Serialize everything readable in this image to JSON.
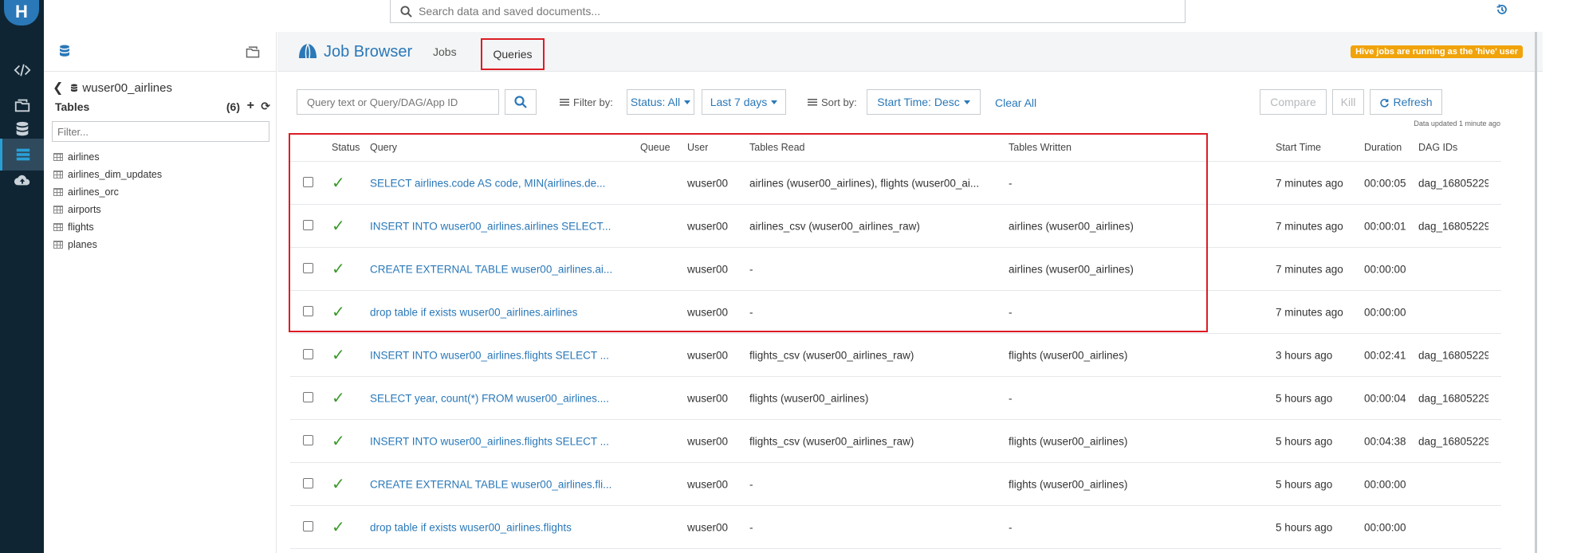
{
  "app": {
    "logo_letter": "H"
  },
  "colors": {
    "accent": "#2a78b8",
    "highlight": "#dc1c24",
    "success": "#3a9a2a",
    "badge": "#f0a30a",
    "rail": "#0f2533"
  },
  "top_search": {
    "placeholder": "Search data and saved documents..."
  },
  "rail_icons": [
    "code-editor-icon",
    "documents-icon",
    "database-icon",
    "job-browser-icon",
    "cloud-upload-icon"
  ],
  "assist": {
    "database": "wuser00_airlines",
    "tables_label": "Tables",
    "tables_count": "(6)",
    "filter_placeholder": "Filter...",
    "tables": [
      "airlines",
      "airlines_dim_updates",
      "airlines_orc",
      "airports",
      "flights",
      "planes"
    ]
  },
  "job_browser": {
    "title": "Job Browser",
    "tabs": {
      "jobs": "Jobs",
      "queries": "Queries"
    },
    "hive_badge": "Hive jobs are running as the 'hive' user"
  },
  "toolbar": {
    "query_placeholder": "Query text or Query/DAG/App ID",
    "filter_by": "Filter by:",
    "status_filter": "Status: All",
    "date_filter": "Last 7 days",
    "sort_by": "Sort by:",
    "sort_value": "Start Time: Desc",
    "clear_all": "Clear All",
    "compare": "Compare",
    "kill": "Kill",
    "refresh": "Refresh",
    "updated": "Data updated 1 minute ago"
  },
  "columns": {
    "status": "Status",
    "query": "Query",
    "queue": "Queue",
    "user": "User",
    "tables_read": "Tables Read",
    "tables_written": "Tables Written",
    "start_time": "Start Time",
    "duration": "Duration",
    "dag_ids": "DAG IDs"
  },
  "rows": [
    {
      "status": "✓",
      "query": "SELECT airlines.code AS code, MIN(airlines.de...",
      "user": "wuser00",
      "tables_read": "airlines (wuser00_airlines), flights (wuser00_ai...",
      "tables_written": "-",
      "start_time": "7 minutes ago",
      "duration": "00:00:05",
      "dag": "dag_16805229"
    },
    {
      "status": "✓",
      "query": "INSERT INTO wuser00_airlines.airlines SELECT...",
      "user": "wuser00",
      "tables_read": "airlines_csv (wuser00_airlines_raw)",
      "tables_written": "airlines (wuser00_airlines)",
      "start_time": "7 minutes ago",
      "duration": "00:00:01",
      "dag": "dag_16805229"
    },
    {
      "status": "✓",
      "query": "CREATE EXTERNAL TABLE wuser00_airlines.ai...",
      "user": "wuser00",
      "tables_read": "-",
      "tables_written": "airlines (wuser00_airlines)",
      "start_time": "7 minutes ago",
      "duration": "00:00:00",
      "dag": ""
    },
    {
      "status": "✓",
      "query": "drop table if exists wuser00_airlines.airlines",
      "user": "wuser00",
      "tables_read": "-",
      "tables_written": "-",
      "start_time": "7 minutes ago",
      "duration": "00:00:00",
      "dag": ""
    },
    {
      "status": "✓",
      "query": "INSERT INTO wuser00_airlines.flights SELECT ...",
      "user": "wuser00",
      "tables_read": "flights_csv (wuser00_airlines_raw)",
      "tables_written": "flights (wuser00_airlines)",
      "start_time": "3 hours ago",
      "duration": "00:02:41",
      "dag": "dag_16805229"
    },
    {
      "status": "✓",
      "query": "SELECT year, count(*) FROM wuser00_airlines....",
      "user": "wuser00",
      "tables_read": "flights (wuser00_airlines)",
      "tables_written": "-",
      "start_time": "5 hours ago",
      "duration": "00:00:04",
      "dag": "dag_16805229"
    },
    {
      "status": "✓",
      "query": "INSERT INTO wuser00_airlines.flights SELECT ...",
      "user": "wuser00",
      "tables_read": "flights_csv (wuser00_airlines_raw)",
      "tables_written": "flights (wuser00_airlines)",
      "start_time": "5 hours ago",
      "duration": "00:04:38",
      "dag": "dag_16805229"
    },
    {
      "status": "✓",
      "query": "CREATE EXTERNAL TABLE wuser00_airlines.fli...",
      "user": "wuser00",
      "tables_read": "-",
      "tables_written": "flights (wuser00_airlines)",
      "start_time": "5 hours ago",
      "duration": "00:00:00",
      "dag": ""
    },
    {
      "status": "✓",
      "query": "drop table if exists wuser00_airlines.flights",
      "user": "wuser00",
      "tables_read": "-",
      "tables_written": "-",
      "start_time": "5 hours ago",
      "duration": "00:00:00",
      "dag": ""
    }
  ]
}
